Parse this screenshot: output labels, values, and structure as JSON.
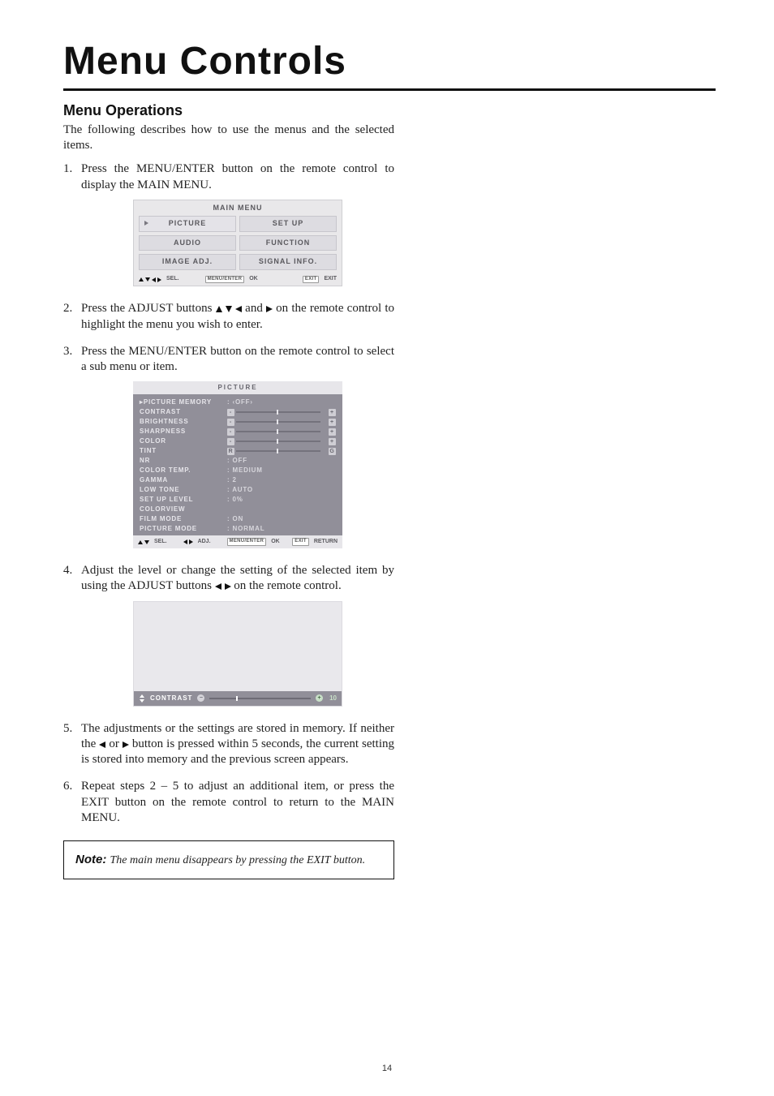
{
  "title": "Menu Controls",
  "section_heading": "Menu Operations",
  "intro": "The following describes how to use the menus and the selected items.",
  "steps": {
    "s1": "Press the MENU/ENTER button on the remote control to display the MAIN MENU.",
    "s2a": "Press the ADJUST buttons ",
    "s2b": " and ",
    "s2c": " on the remote control to highlight the menu you wish to enter.",
    "s3": "Press the MENU/ENTER button on the remote control to select a sub menu or item.",
    "s4a": "Adjust the level or change the setting of the selected item by using the ADJUST buttons ",
    "s4b": " on the remote control.",
    "s5a": "The adjustments or the settings are stored in memory. If neither the ",
    "s5b": " or ",
    "s5c": " button is pressed within 5 seconds, the current setting is stored into memory and the previous screen appears.",
    "s6": "Repeat steps 2 – 5 to adjust an additional item, or press the EXIT button on the remote control to return to the MAIN MENU."
  },
  "main_menu": {
    "title": "MAIN MENU",
    "items": [
      "PICTURE",
      "SET UP",
      "AUDIO",
      "FUNCTION",
      "IMAGE ADJ.",
      "SIGNAL INFO."
    ],
    "footer_sel": "SEL.",
    "footer_ok_key": "MENU/ENTER",
    "footer_ok": "OK",
    "footer_exit_key": "EXIT",
    "footer_exit": "EXIT"
  },
  "picture_menu": {
    "title": "PICTURE",
    "rows": [
      {
        "label": "PICTURE MEMORY",
        "value": "OFF",
        "type": "lr"
      },
      {
        "label": "CONTRAST",
        "type": "slider",
        "caps": [
          "-",
          "+"
        ]
      },
      {
        "label": "BRIGHTNESS",
        "type": "slider",
        "caps": [
          "-",
          "+"
        ]
      },
      {
        "label": "SHARPNESS",
        "type": "slider",
        "caps": [
          "-",
          "+"
        ]
      },
      {
        "label": "COLOR",
        "type": "slider",
        "caps": [
          "-",
          "+"
        ]
      },
      {
        "label": "TINT",
        "type": "slider",
        "caps": [
          "R",
          "G"
        ]
      },
      {
        "label": "NR",
        "value": "OFF",
        "type": "text"
      },
      {
        "label": "COLOR TEMP.",
        "value": "MEDIUM",
        "type": "text"
      },
      {
        "label": "GAMMA",
        "value": "2",
        "type": "text"
      },
      {
        "label": "LOW TONE",
        "value": "AUTO",
        "type": "text"
      },
      {
        "label": "SET UP LEVEL",
        "value": "0%",
        "type": "text"
      },
      {
        "label": "COLORVIEW",
        "value": "",
        "type": "text"
      },
      {
        "label": "FILM MODE",
        "value": "ON",
        "type": "text"
      },
      {
        "label": "PICTURE MODE",
        "value": "NORMAL",
        "type": "text"
      }
    ],
    "footer_sel": "SEL.",
    "footer_adj": "ADJ.",
    "footer_ok_key": "MENU/ENTER",
    "footer_ok": "OK",
    "footer_ret_key": "EXIT",
    "footer_ret": "RETURN"
  },
  "contrast_bar": {
    "label": "CONTRAST",
    "value": "10"
  },
  "note": {
    "label": "Note: ",
    "text": "The main menu disappears by pressing the EXIT button."
  },
  "page_number": "14",
  "chart_data": {
    "type": "table",
    "title": "PICTURE submenu settings",
    "rows": [
      [
        "PICTURE MEMORY",
        "OFF"
      ],
      [
        "NR",
        "OFF"
      ],
      [
        "COLOR TEMP.",
        "MEDIUM"
      ],
      [
        "GAMMA",
        "2"
      ],
      [
        "LOW TONE",
        "AUTO"
      ],
      [
        "SET UP LEVEL",
        "0%"
      ],
      [
        "FILM MODE",
        "ON"
      ],
      [
        "PICTURE MODE",
        "NORMAL"
      ],
      [
        "CONTRAST (adjust bar)",
        "10"
      ]
    ]
  }
}
